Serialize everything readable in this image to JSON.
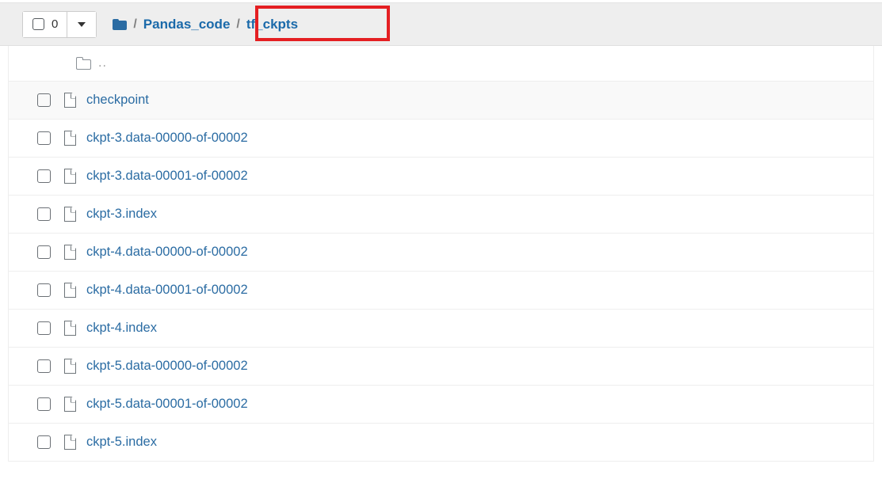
{
  "toolbar": {
    "select_all_checkbox_label": "select-all",
    "selected_count": "0",
    "dropdown_caret": "▼"
  },
  "breadcrumb": {
    "root_icon": "folder-icon",
    "separator": "/",
    "items": [
      {
        "label": "Pandas_code"
      },
      {
        "label": "tf_ckpts"
      }
    ],
    "highlighted_index": 1
  },
  "annotation": {
    "color": "#e41f22",
    "target": "tf_ckpts"
  },
  "colors": {
    "link": "#2b6ca3",
    "header_bg": "#eeeeee",
    "row_alt_bg": "#f9f9f9",
    "muted": "#9a9a9a"
  },
  "file_list": {
    "parent_row": {
      "icon": "folder-icon",
      "name": ".."
    },
    "rows": [
      {
        "icon": "file-icon",
        "name": "checkpoint"
      },
      {
        "icon": "file-icon",
        "name": "ckpt-3.data-00000-of-00002"
      },
      {
        "icon": "file-icon",
        "name": "ckpt-3.data-00001-of-00002"
      },
      {
        "icon": "file-icon",
        "name": "ckpt-3.index"
      },
      {
        "icon": "file-icon",
        "name": "ckpt-4.data-00000-of-00002"
      },
      {
        "icon": "file-icon",
        "name": "ckpt-4.data-00001-of-00002"
      },
      {
        "icon": "file-icon",
        "name": "ckpt-4.index"
      },
      {
        "icon": "file-icon",
        "name": "ckpt-5.data-00000-of-00002"
      },
      {
        "icon": "file-icon",
        "name": "ckpt-5.data-00001-of-00002"
      },
      {
        "icon": "file-icon",
        "name": "ckpt-5.index"
      }
    ]
  }
}
